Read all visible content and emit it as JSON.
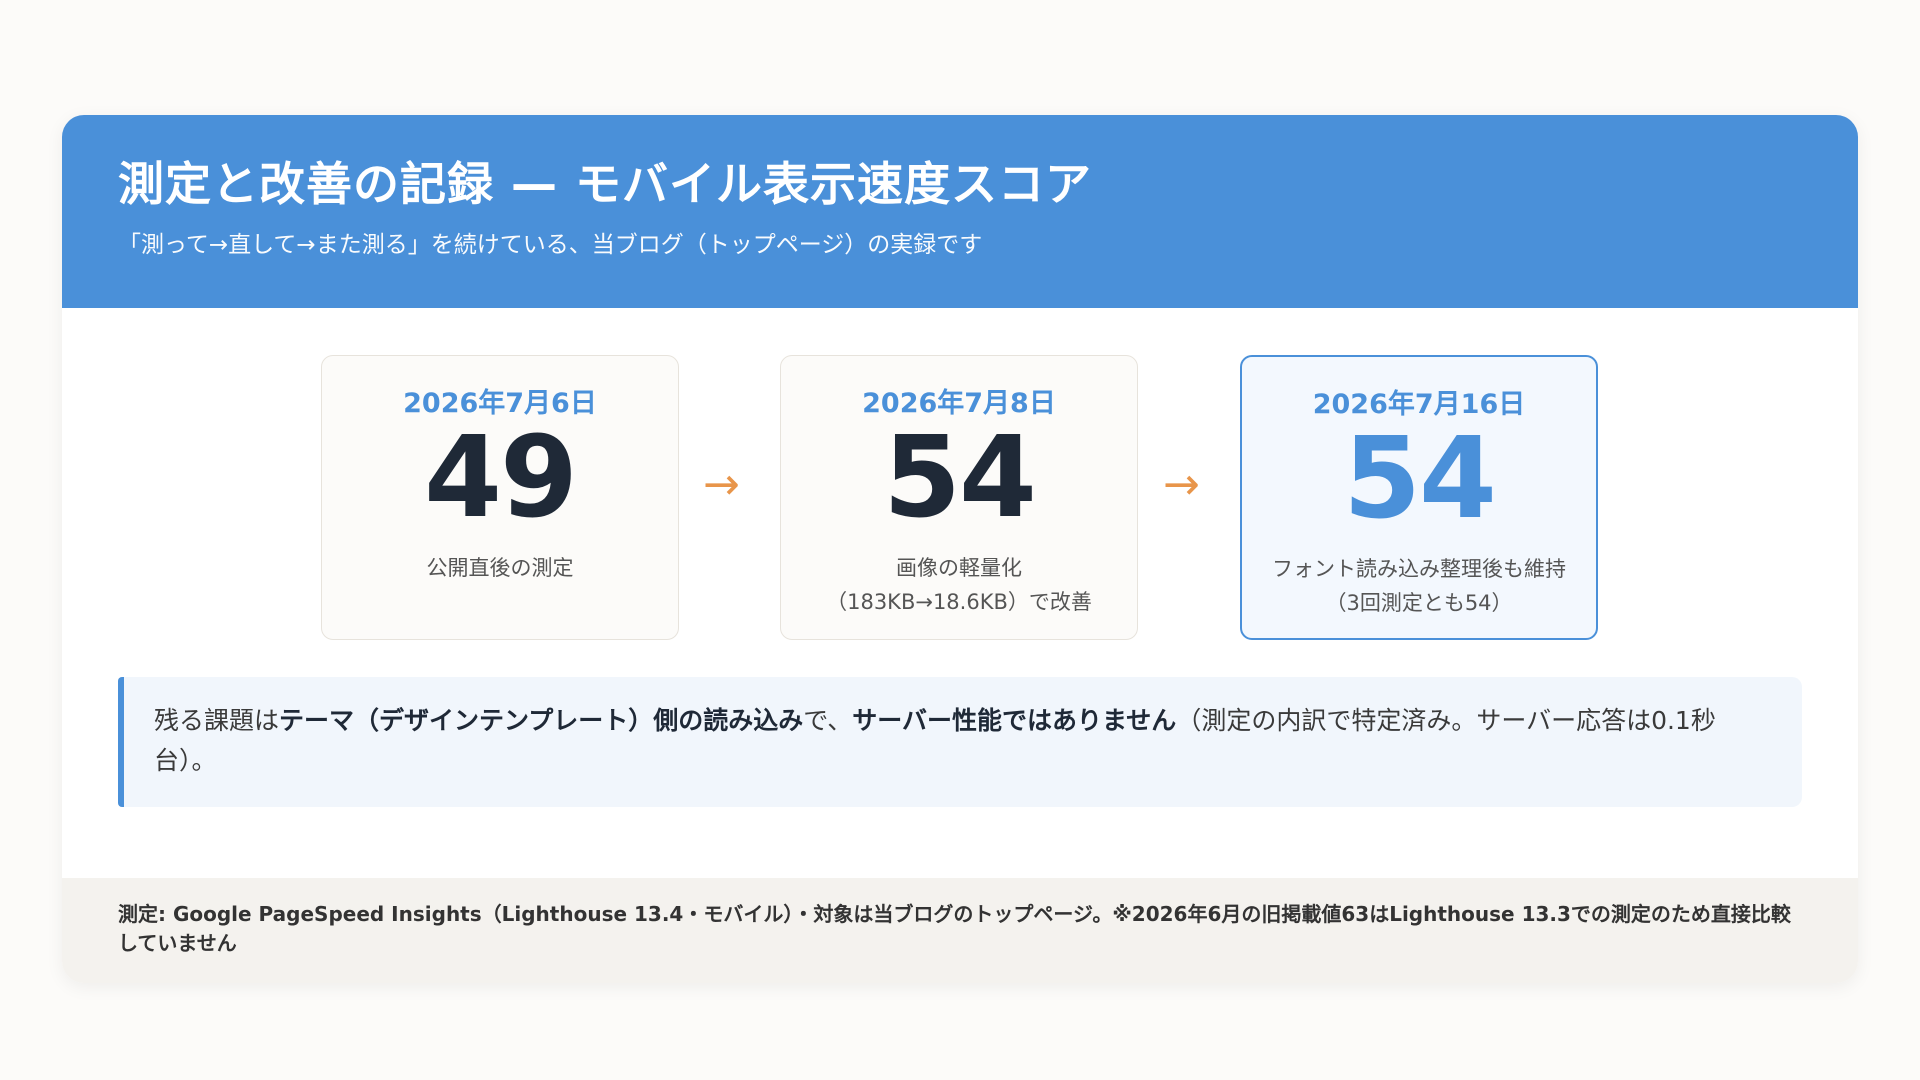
{
  "header": {
    "title": "測定と改善の記録 — モバイル表示速度スコア",
    "subtitle": "「測って→直して→また測る」を続けている、当ブログ（トップページ）の実録です"
  },
  "stages": [
    {
      "date": "2026年7月6日",
      "score": "49",
      "note_line1": "公開直後の測定",
      "note_line2": ""
    },
    {
      "date": "2026年7月8日",
      "score": "54",
      "note_line1": "画像の軽量化",
      "note_line2": "（183KB→18.6KB）で改善"
    },
    {
      "date": "2026年7月16日",
      "score": "54",
      "note_line1": "フォント読み込み整理後も維持",
      "note_line2": "（3回測定とも54）"
    }
  ],
  "arrows": [
    "→",
    "→"
  ],
  "callout": {
    "part1": "残る課題は",
    "bold1": "テーマ（デザインテンプレート）側の読み込み",
    "part2": "で、",
    "bold2": "サーバー性能ではありません",
    "part3": "（測定の内訳で特定済み。サーバー応答は0.1秒台）。"
  },
  "footer": {
    "text": "測定: Google PageSpeed Insights（Lighthouse 13.4・モバイル）・対象は当ブログのトップページ。※2026年6月の旧掲載値63はLighthouse 13.3での測定のため直接比較していません"
  },
  "colors": {
    "accent": "#4a90d9",
    "arrow": "#e8954a",
    "score_dark": "#1f2937"
  }
}
